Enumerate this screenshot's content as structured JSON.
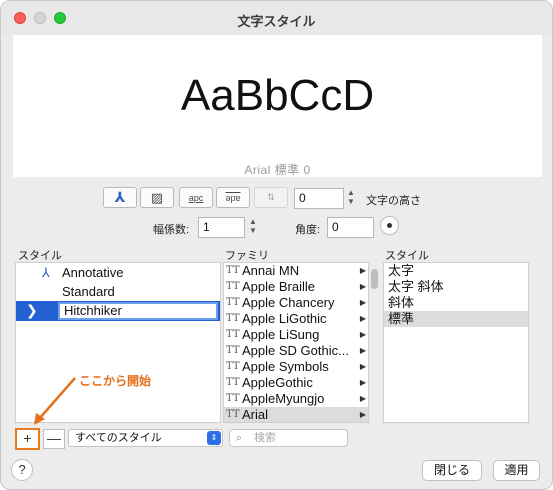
{
  "window": {
    "title": "文字スタイル"
  },
  "preview": {
    "sample": "AaBbCcD",
    "info": "Arial   標準   0"
  },
  "toolbar": {
    "buttons": [
      {
        "name": "annotative-icon",
        "glyph": "⅄"
      },
      {
        "name": "background-mask-icon",
        "glyph": "▨"
      },
      {
        "name": "spacing-icon",
        "glyph": "apc"
      },
      {
        "name": "vertical-text-icon",
        "glyph": "ǝpɐ"
      },
      {
        "name": "upside-down-icon",
        "glyph": "⇅"
      }
    ],
    "height_value": "0",
    "height_label": "文字の高さ",
    "width_factor_label": "幅係数:",
    "width_factor_value": "1",
    "angle_label": "角度:",
    "angle_value": "0"
  },
  "styles_panel": {
    "header": "スタイル",
    "items": [
      {
        "label": "Annotative",
        "annotative": true
      },
      {
        "label": "Standard",
        "annotative": false
      },
      {
        "label": "Hitchhiker",
        "annotative": false,
        "editing": true
      }
    ]
  },
  "family_panel": {
    "header": "ファミリ",
    "items": [
      "Annai MN",
      "Apple Braille",
      "Apple Chancery",
      "Apple LiGothic",
      "Apple LiSung",
      "Apple SD Gothic...",
      "Apple Symbols",
      "AppleGothic",
      "AppleMyungjo",
      "Arial"
    ],
    "selected": "Arial"
  },
  "variant_panel": {
    "header": "スタイル",
    "items": [
      "太字",
      "太字 斜体",
      "斜体",
      "標準"
    ],
    "selected": "標準"
  },
  "annotation": {
    "text": "ここから開始",
    "color": "#e56f1a"
  },
  "bottom_bar": {
    "add_label": "+",
    "remove_label": "—",
    "filter_value": "すべてのスタイル",
    "search_placeholder": "検索"
  },
  "footer": {
    "help_label": "?",
    "close_label": "閉じる",
    "apply_label": "適用"
  },
  "colors": {
    "accent": "#2560d2",
    "annotation": "#e56f1a"
  }
}
